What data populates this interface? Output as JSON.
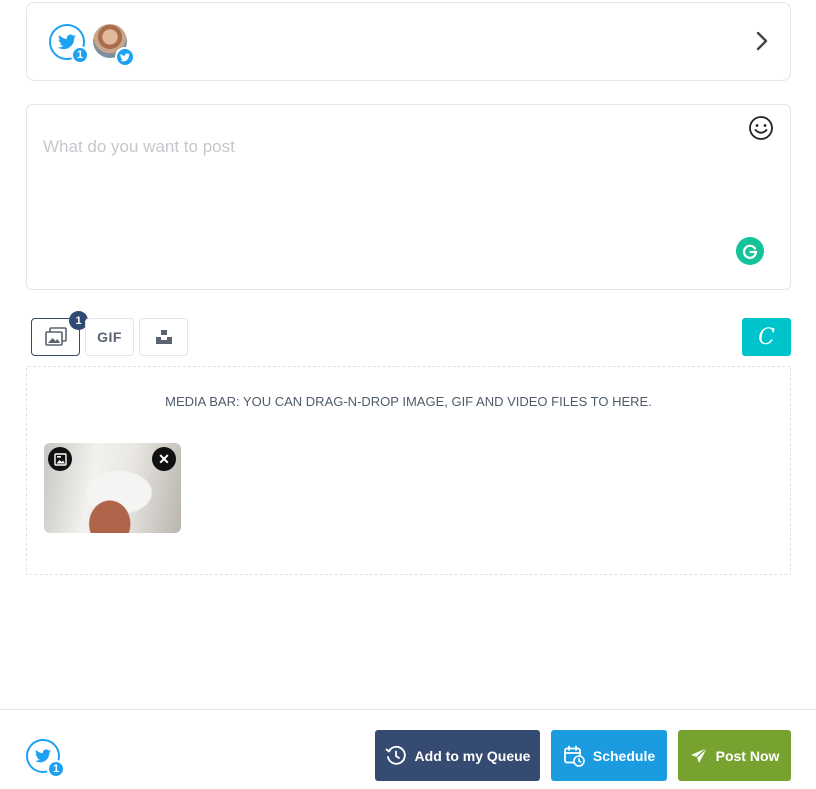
{
  "accounts": {
    "twitter_selected_count": "1",
    "avatar_icon": "user-avatar"
  },
  "composer": {
    "placeholder": "What do you want to post",
    "value": ""
  },
  "media_tools": {
    "image_count": "1",
    "gif_label": "GIF",
    "canva_label": "C"
  },
  "media_bar": {
    "hint": "MEDIA BAR: YOU CAN DRAG-N-DROP IMAGE, GIF AND VIDEO FILES TO HERE.",
    "remove_glyph": "✕"
  },
  "footer": {
    "twitter_count": "1",
    "queue_label": "Add to my Queue",
    "schedule_label": "Schedule",
    "post_label": "Post Now"
  },
  "colors": {
    "twitter": "#1da1f2",
    "queue": "#364b72",
    "schedule": "#1c9ce0",
    "post": "#77a22f",
    "canva": "#00c4cc",
    "grammarly": "#15c39a"
  }
}
